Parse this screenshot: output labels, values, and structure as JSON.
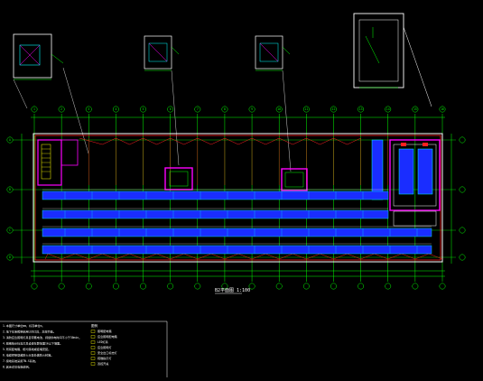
{
  "colors": {
    "background": "#000000",
    "grid_axis": "#00ff00",
    "wall_red": "#ff2020",
    "room_magenta": "#ff00ff",
    "panel_blue": "#1a2dff",
    "cyan": "#00ffff",
    "white": "#ffffff",
    "yellow": "#ffff00"
  },
  "axis_labels": {
    "columns": [
      "1",
      "2",
      "3",
      "4",
      "5",
      "6",
      "7",
      "8",
      "9",
      "10",
      "11",
      "12",
      "13",
      "14",
      "15",
      "16"
    ],
    "rows": [
      "A",
      "B",
      "C",
      "D"
    ]
  },
  "plan": {
    "title": "B2平面图 1:100"
  },
  "notes": {
    "left": [
      "1.本图尺寸单位mm，标高单位m。",
      "2.地下车库照明采用LED灯具，高效节能。",
      "3.消防应急照明灯具自带蓄电池，持续供电时间不小于30min。",
      "4.疏散指示标志灯具设置在距地面1m以下墙面。",
      "5.所有配电箱、柜均落地或挂墙安装。",
      "6.电缆桥架穿越防火分区处做防火封堵。",
      "7.接地系统采用TN-S系统。",
      "8.其余详见电施说明。"
    ],
    "legend_title": "图例",
    "legend": [
      "照明配电箱",
      "应急照明配电箱",
      "LED灯具",
      "应急照明灯",
      "安全出口标志灯",
      "疏散指示灯",
      "双控开关"
    ]
  }
}
